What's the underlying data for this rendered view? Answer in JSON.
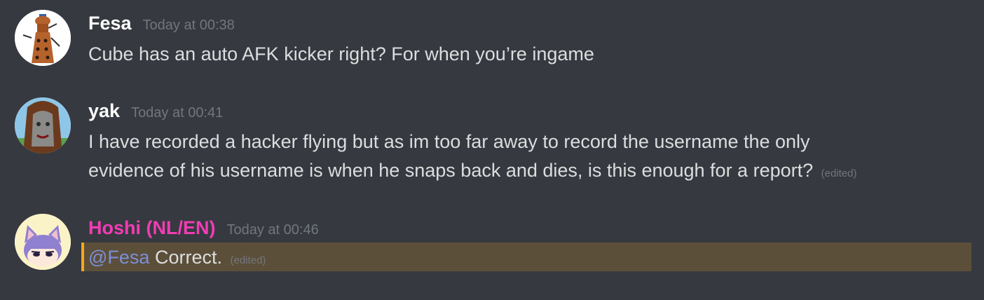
{
  "colors": {
    "background": "#36393f",
    "hoshi_name": "#f03db4",
    "mention_text": "#7b8fd9",
    "mention_highlight": "#5c4f3a",
    "mention_bar": "#faa61a"
  },
  "messages": [
    {
      "author": "Fesa",
      "timestamp": "Today at 00:38",
      "lines": [
        "Cube has an auto AFK kicker right? For when you’re ingame"
      ],
      "avatar_icon": "dalek-avatar"
    },
    {
      "author": "yak",
      "timestamp": "Today at 00:41",
      "lines": [
        "I have recorded a hacker flying but as im too far away to record the username the only",
        "evidence of his username is when he snaps back and dies, is this enough for a report?"
      ],
      "edited": "(edited)",
      "avatar_icon": "stone-face-avatar"
    },
    {
      "author": "Hoshi (NL/EN)",
      "timestamp": "Today at 00:46",
      "mention": "@Fesa",
      "text": "Correct.",
      "edited": "(edited)",
      "avatar_icon": "catgirl-avatar"
    }
  ]
}
